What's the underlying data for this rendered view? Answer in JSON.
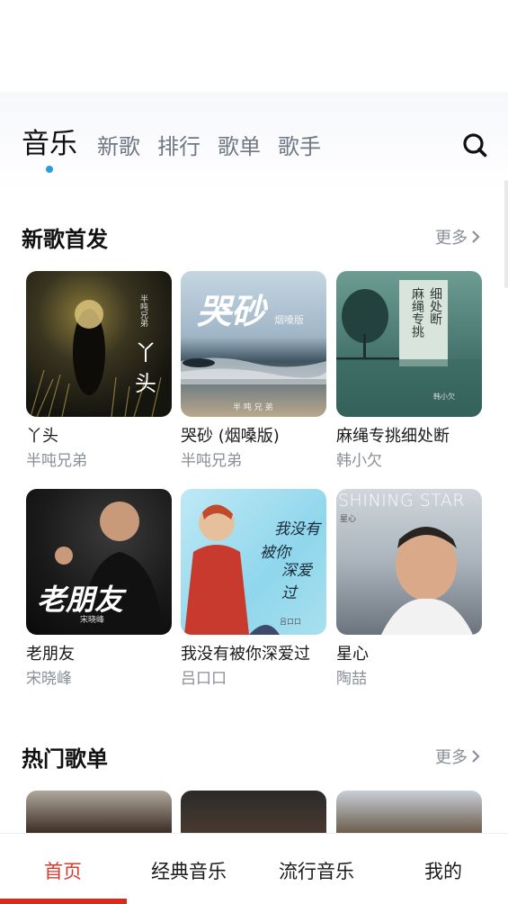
{
  "tabs": [
    {
      "label": "音乐",
      "active": true
    },
    {
      "label": "新歌"
    },
    {
      "label": "排行"
    },
    {
      "label": "歌单"
    },
    {
      "label": "歌手"
    }
  ],
  "accent_color": "#d93a2b",
  "new_songs": {
    "title": "新歌首发",
    "more": "更多",
    "items": [
      {
        "title": "丫头",
        "artist": "半吨兄弟",
        "cover_text": [
          "丫",
          "头"
        ],
        "cover_small": "半吨兄弟"
      },
      {
        "title": "哭砂 (烟嗓版)",
        "artist": "半吨兄弟",
        "cover_text": [
          "哭砂",
          "烟嗓版"
        ],
        "cover_small": "半 吨 兄 弟"
      },
      {
        "title": "麻绳专挑细处断",
        "artist": "韩小欠",
        "cover_text": [
          "麻绳专挑",
          "细处断"
        ],
        "cover_small": "韩小欠"
      },
      {
        "title": "老朋友",
        "artist": "宋晓峰",
        "cover_text": [
          "老朋友"
        ],
        "cover_small": "宋晓峰"
      },
      {
        "title": "我没有被你深爱过",
        "artist": "吕口口",
        "cover_text": [
          "我没有",
          "被你",
          "深爱过"
        ],
        "cover_small": "吕口口"
      },
      {
        "title": "星心",
        "artist": "陶喆",
        "cover_text": [
          "SHINING STAR"
        ],
        "cover_small": "星心"
      }
    ]
  },
  "hot_playlists": {
    "title": "热门歌单",
    "more": "更多"
  },
  "bottom_nav": [
    {
      "label": "首页",
      "active": true
    },
    {
      "label": "经典音乐"
    },
    {
      "label": "流行音乐"
    },
    {
      "label": "我的"
    }
  ]
}
